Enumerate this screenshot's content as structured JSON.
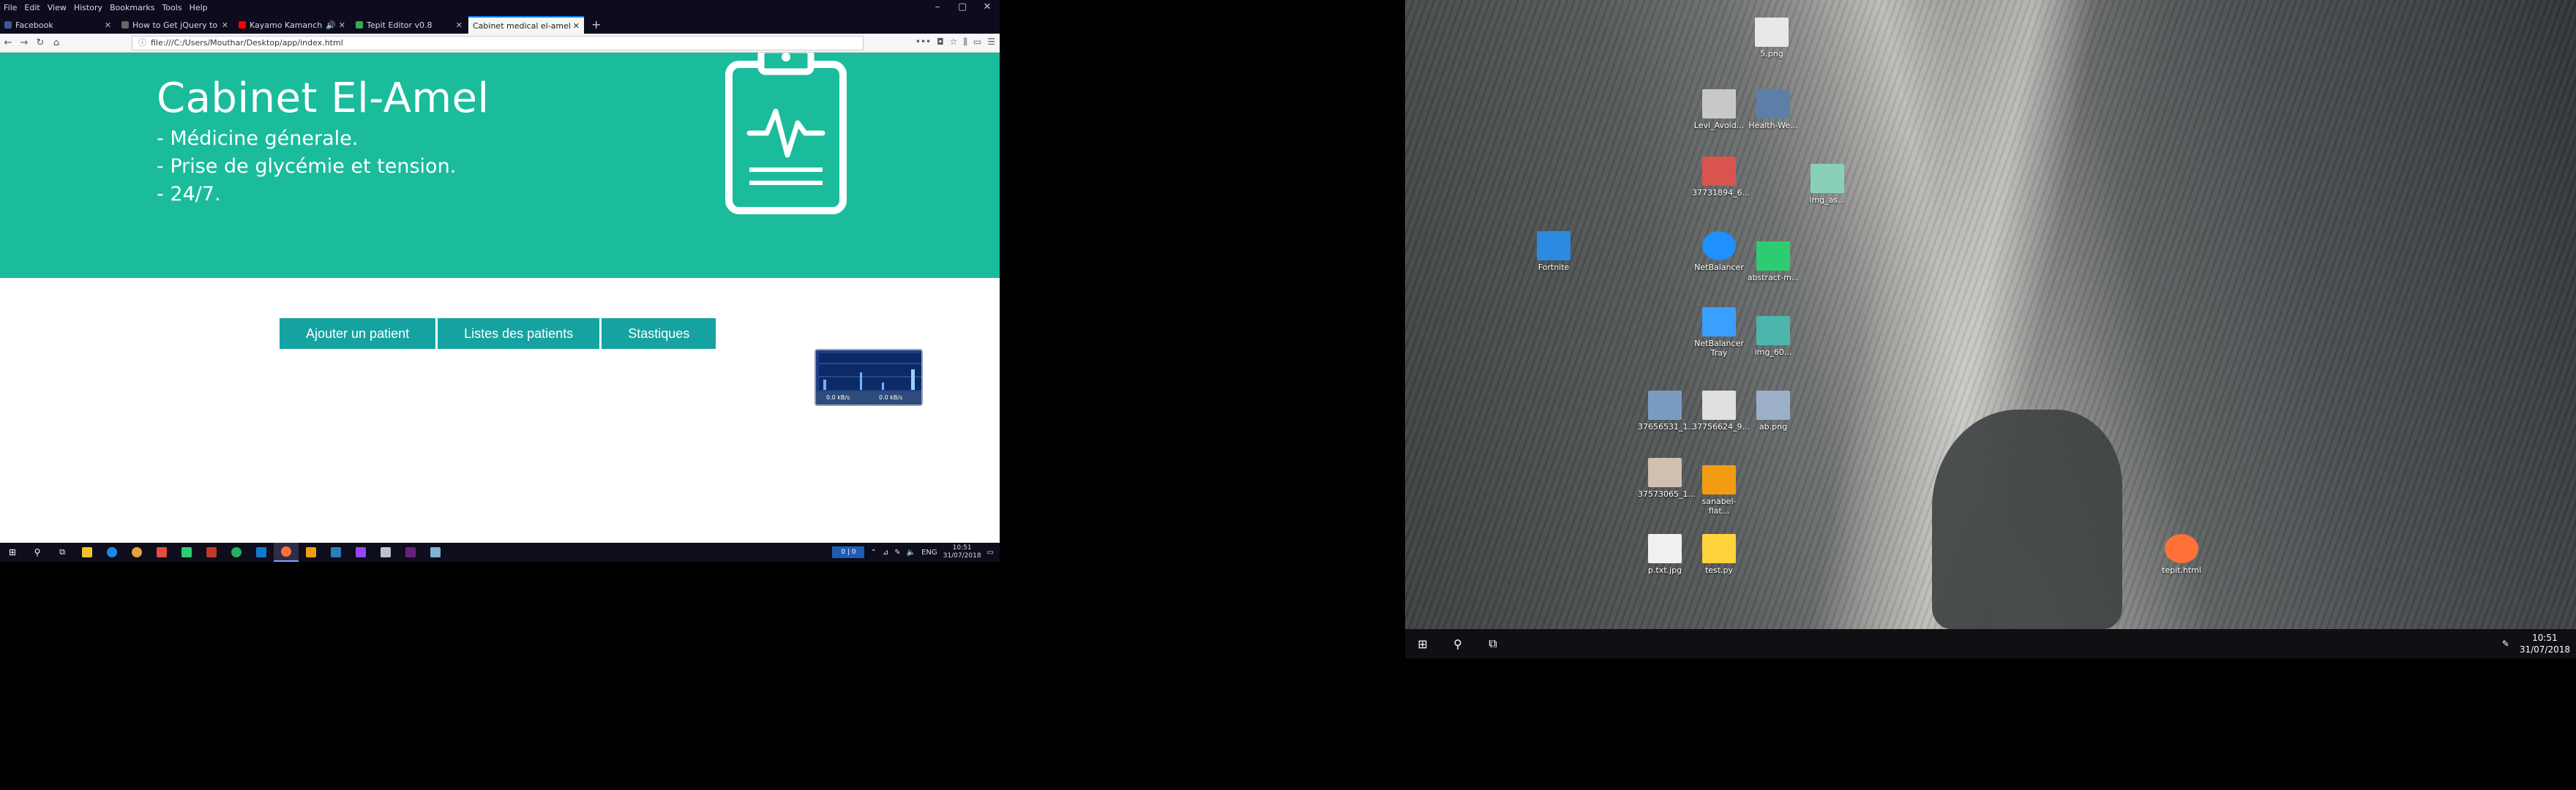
{
  "browser": {
    "menu": [
      "File",
      "Edit",
      "View",
      "History",
      "Bookmarks",
      "Tools",
      "Help"
    ],
    "tabs": [
      {
        "title": "Facebook",
        "color": "#3b5998",
        "active": false
      },
      {
        "title": "How to Get jQuery to Make Sliding",
        "color": "#666666",
        "active": false
      },
      {
        "title": "Kayamo Kamanchiren - Ta vie",
        "color": "#ff0000",
        "active": false
      },
      {
        "title": "Tepit Editor v0.8",
        "color": "#3da55a",
        "active": false
      },
      {
        "title": "Cabinet medical el-amel",
        "color": "#ffffff",
        "active": true
      }
    ],
    "url": "file:///C:/Users/Mouthar/Desktop/app/index.html"
  },
  "page": {
    "title": "Cabinet El-Amel",
    "lines": [
      "- Médicine génerale.",
      "- Prise de glycémie et tension.",
      "- 24/7."
    ],
    "buttons": [
      "Ajouter un patient",
      "Listes des patients",
      "Stastiques"
    ],
    "hero_color": "#1abc9c",
    "button_color": "#17a2a2"
  },
  "widget": {
    "down": "0.0 kB/s",
    "up": "0.0 kB/s"
  },
  "taskbar_left": {
    "netmeter": "0 | 0",
    "language": "ENG",
    "time": "10:51",
    "date": "31/07/2018"
  },
  "desktop": {
    "icons": [
      {
        "label": "5.png",
        "color": "#e8e8e8"
      },
      {
        "label": "Levi_Avoid...",
        "color": "#c8c8c8"
      },
      {
        "label": "Health-We...",
        "color": "#5c7fa8"
      },
      {
        "label": "37731894_6...",
        "color": "#d9534f"
      },
      {
        "label": "img_as...",
        "color": "#8ad0b8"
      },
      {
        "label": "Fortnite",
        "color": "#2b8be0"
      },
      {
        "label": "NetBalancer",
        "color": "#1e90ff"
      },
      {
        "label": "abstract-m...",
        "color": "#2ecc71"
      },
      {
        "label": "NetBalancer Tray",
        "color": "#3aa0ff"
      },
      {
        "label": "img_60...",
        "color": "#4db6ac"
      },
      {
        "label": "37656531_1...",
        "color": "#7a9cc0"
      },
      {
        "label": "37756624_9...",
        "color": "#e0e0e0"
      },
      {
        "label": "ab.png",
        "color": "#9bb0c8"
      },
      {
        "label": "37573065_1...",
        "color": "#d0c0b0"
      },
      {
        "label": "sanabel-flat...",
        "color": "#f39c12"
      },
      {
        "label": "p.txt.jpg",
        "color": "#f0f0f0"
      },
      {
        "label": "test.py",
        "color": "#ffd43b"
      },
      {
        "label": "tepit.html",
        "color": "#ff7139"
      }
    ]
  },
  "taskbar_right": {
    "time": "10:51",
    "date": "31/07/2018"
  }
}
